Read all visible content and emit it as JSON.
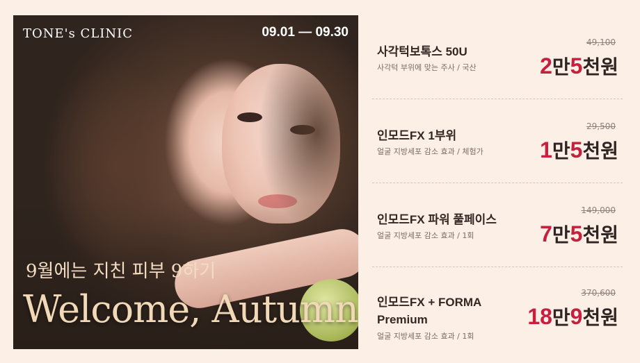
{
  "banner": {
    "brand": "TONE's CLINIC",
    "date_range": "09.01 — 09.30",
    "tagline": "9월에는 지친 피부 9하기",
    "headline": "Welcome, Autumn!"
  },
  "items": [
    {
      "name": "사각턱보톡스 50U",
      "description": "사각턱 부위에 맞는 주사 / 국산",
      "original_price": "49,100",
      "price_parts": [
        "2",
        "만",
        "5",
        "천원"
      ]
    },
    {
      "name": "인모드FX 1부위",
      "description": "얼굴 지방세포 감소 효과 / 체험가",
      "original_price": "29,500",
      "price_parts": [
        "1",
        "만",
        "5",
        "천원"
      ]
    },
    {
      "name": "인모드FX 파워 풀페이스",
      "description": "얼굴 지방세포 감소 효과 / 1회",
      "original_price": "149,000",
      "price_parts": [
        "7",
        "만",
        "5",
        "천원"
      ]
    },
    {
      "name": "인모드FX + FORMA Premium",
      "description": "얼굴 지방세포 감소 효과 / 1회",
      "original_price": "370,600",
      "price_parts": [
        "18",
        "만",
        "9",
        "천원"
      ]
    }
  ],
  "colors": {
    "background": "#fcefe6",
    "accent": "#c5203e",
    "text": "#332623"
  }
}
